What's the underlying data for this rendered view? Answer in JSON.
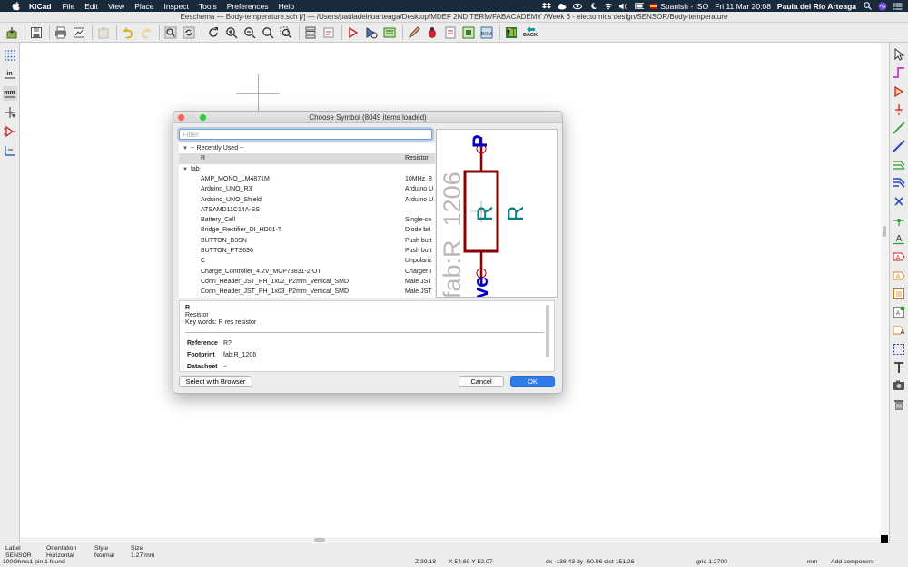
{
  "menubar": {
    "app_name": "KiCad",
    "items": [
      "File",
      "Edit",
      "View",
      "Place",
      "Inspect",
      "Tools",
      "Preferences",
      "Help"
    ],
    "input_source": "Spanish - ISO",
    "clock": "Fri 11 Mar  20:08",
    "user": "Paula del Río Arteaga"
  },
  "window": {
    "title": "Eeschema — Body-temperature.sch [/] — /Users/pauladelrioarteaga/Desktop/MDEF 2ND TERM/FABACADEMY /Week 6 - electornics design/SENSOR/Body-temperature"
  },
  "toolbar": {
    "back_label": "BACK",
    "icons": [
      "new-schematic-icon",
      "save-icon",
      "print-icon",
      "plot-icon",
      "paste-icon",
      "undo-icon",
      "redo-icon",
      "find-icon",
      "find-replace-icon",
      "refresh-icon",
      "zoom-in-icon",
      "zoom-out-icon",
      "zoom-fit-icon",
      "zoom-selection-icon",
      "hierarchy-navigator-icon",
      "leave-sheet-icon",
      "symbol-editor-icon",
      "symbol-browser-icon",
      "annotate-icon",
      "erc-icon",
      "netlist-icon",
      "assign-footprints-icon",
      "bom-icon",
      "pcbnew-icon"
    ]
  },
  "left_toolbar": {
    "inch_label": "in",
    "mm_label": "mm"
  },
  "status": {
    "label_header": "Label",
    "label_value": "SENSOR",
    "orientation_header": "Orientation",
    "orientation_value": "Horizontal",
    "style_header": "Style",
    "style_value": "Normal",
    "size_header": "Size",
    "size_value": "1.27 mm",
    "message": "100Ohms1 pin 1 found",
    "zoom": "Z 39.18",
    "coords": "X 54.60  Y 52.07",
    "delta": "dx -138.43  dy -60.96  dist 151.26",
    "grid": "grid 1.2700",
    "units": "mm",
    "mode": "Add component"
  },
  "dialog": {
    "title": "Choose Symbol (8049 items loaded)",
    "filter_placeholder": "Filter",
    "recently_used_label": "-- Recently Used --",
    "recent_items": [
      {
        "name": "R",
        "desc": "Resistor"
      }
    ],
    "fab_group": "fab",
    "fab_items": [
      {
        "name": "AMP_MONO_LM4871M",
        "desc": "10MHz, 8"
      },
      {
        "name": "Arduino_UNO_R3",
        "desc": "Arduino U"
      },
      {
        "name": "Arduino_UNO_Shield",
        "desc": "Arduino U"
      },
      {
        "name": "ATSAMD11C14A-SS",
        "desc": ""
      },
      {
        "name": "Battery_Cell",
        "desc": "Single-ce"
      },
      {
        "name": "Bridge_Rectifier_DI_HD01-T",
        "desc": "Diode bri"
      },
      {
        "name": "BUTTON_B3SN",
        "desc": "Push butt"
      },
      {
        "name": "BUTTON_PTS636",
        "desc": "Push butt"
      },
      {
        "name": "C",
        "desc": "Unpolariz"
      },
      {
        "name": "Charge_Controller_4.2V_MCP73831-2-OT",
        "desc": "Charger I"
      },
      {
        "name": "Conn_Header_JST_PH_1x02_P2mm_Vertical_SMD",
        "desc": "Male JST"
      },
      {
        "name": "Conn_Header_JST_PH_1x03_P2mm_Vertical_SMD",
        "desc": "Male JST"
      }
    ],
    "preview": {
      "footprint_text": "fab:R_1206",
      "ref_text": "R",
      "value_text": "R",
      "pin_top": "P",
      "value_partial": "ve"
    },
    "details": {
      "name": "R",
      "description": "Resistor",
      "keywords": "Key words: R res resistor",
      "reference_label": "Reference",
      "reference_value": "R?",
      "footprint_label": "Footprint",
      "footprint_value": "fab:R_1206",
      "datasheet_label": "Datasheet",
      "datasheet_value": "~"
    },
    "buttons": {
      "browser": "Select with Browser",
      "cancel": "Cancel",
      "ok": "OK"
    }
  }
}
